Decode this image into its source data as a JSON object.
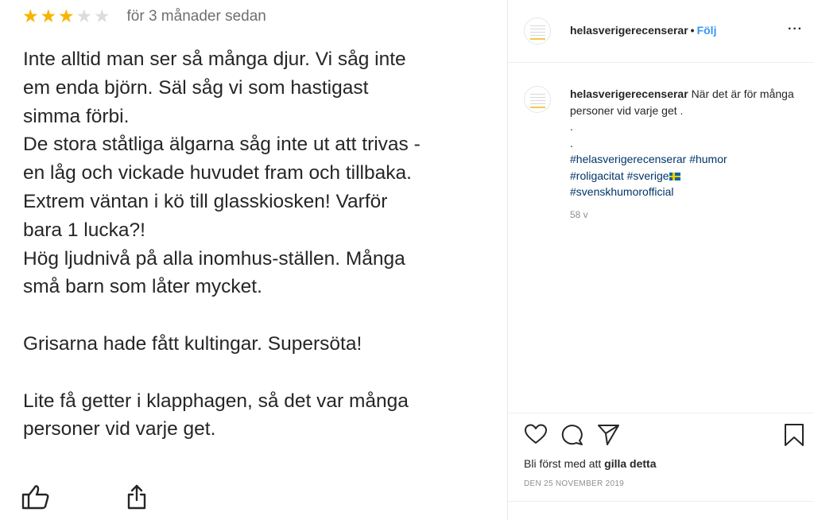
{
  "review": {
    "rating": 3,
    "rating_max": 5,
    "age": "för 3 månader sedan",
    "lines": [
      "Inte alltid man ser så många djur. Vi såg inte",
      "em enda björn. Säl såg vi som hastigast",
      "simma förbi.",
      "De stora ståtliga älgarna såg inte ut att trivas -",
      "en låg och vickade huvudet fram och tillbaka.",
      "Extrem väntan i kö till glasskiosken! Varför",
      "bara 1 lucka?!",
      "Hög ljudnivå på alla inomhus-ställen. Många",
      "små barn som låter mycket.",
      "",
      "Grisarna hade fått kultingar. Supersöta!",
      "",
      "Lite få getter i klapphagen, så det var många",
      "personer vid varje get."
    ],
    "icons": {
      "like": "thumbs-up-icon",
      "share": "share-icon"
    }
  },
  "instagram": {
    "username": "helasverigerecenserar",
    "dot": "•",
    "follow_label": "Följ",
    "more_label": "···",
    "caption": {
      "username": "helasverigerecenserar",
      "text": "När det är för många personer vid varje get .",
      "dot_line_1": ".",
      "dot_line_2": ".",
      "hashtags": {
        "h1": "#helasverigerecenserar",
        "h2": "#humor",
        "h3": "#roligacitat",
        "h4": "#sverige",
        "h5": "#svenskhumorofficial"
      },
      "age": "58 v"
    },
    "likes_text": "Bli först med att",
    "likes_bold": "gilla detta",
    "date": "DEN 25 NOVEMBER 2019",
    "icons": {
      "like": "heart-icon",
      "comment": "comment-icon",
      "share": "send-icon",
      "save": "bookmark-icon"
    }
  },
  "colors": {
    "star_on": "#f6b400",
    "star_off": "#dcdcdc",
    "follow_blue": "#3897f0",
    "hashtag": "#003569"
  }
}
